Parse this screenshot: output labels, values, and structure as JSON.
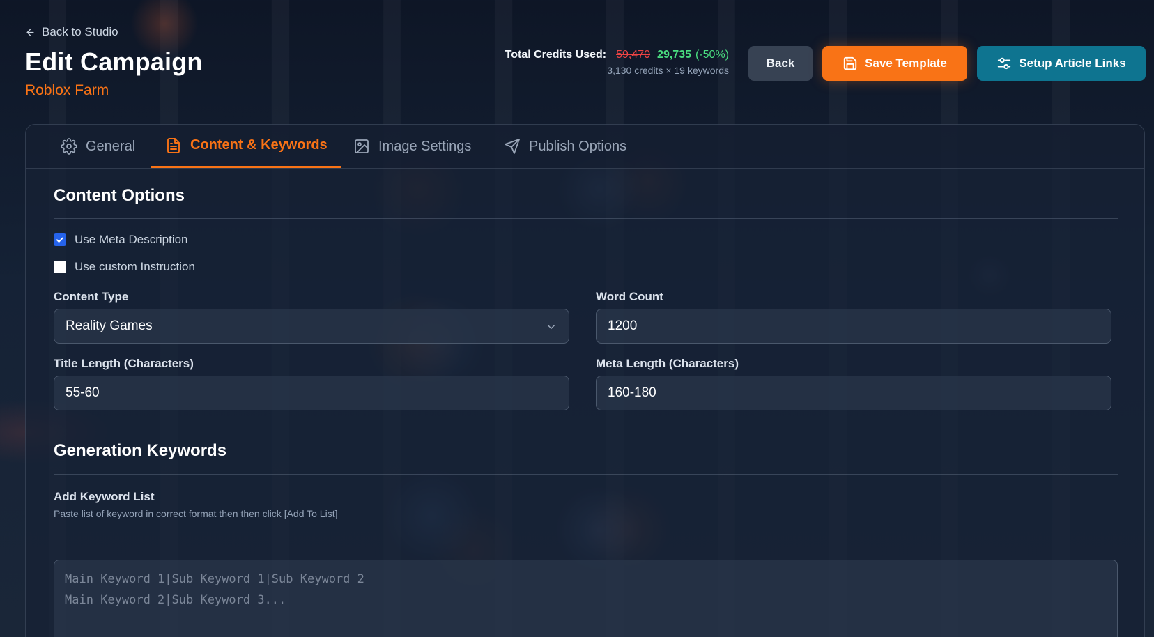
{
  "header": {
    "back_link": "Back to Studio",
    "title": "Edit Campaign",
    "campaign_name": "Roblox Farm"
  },
  "credits": {
    "label": "Total Credits Used:",
    "original": "59,470",
    "discounted": "29,735",
    "discount": "(-50%)",
    "breakdown": "3,130 credits × 19 keywords"
  },
  "actions": {
    "back": "Back",
    "save_template": "Save Template",
    "setup_links": "Setup Article Links"
  },
  "tabs": [
    {
      "label": "General",
      "icon": "gear-icon",
      "active": false
    },
    {
      "label": "Content & Keywords",
      "icon": "document-icon",
      "active": true
    },
    {
      "label": "Image Settings",
      "icon": "image-icon",
      "active": false
    },
    {
      "label": "Publish Options",
      "icon": "send-icon",
      "active": false
    }
  ],
  "content_options": {
    "title": "Content Options",
    "use_meta_description": {
      "label": "Use Meta Description",
      "checked": true
    },
    "use_custom_instruction": {
      "label": "Use custom Instruction",
      "checked": false
    },
    "content_type": {
      "label": "Content Type",
      "value": "Reality Games"
    },
    "word_count": {
      "label": "Word Count",
      "value": "1200"
    },
    "title_length": {
      "label": "Title Length (Characters)",
      "value": "55-60"
    },
    "meta_length": {
      "label": "Meta Length (Characters)",
      "value": "160-180"
    }
  },
  "generation_keywords": {
    "title": "Generation Keywords",
    "add_list_label": "Add Keyword List",
    "help": "Paste list of keyword in correct format then then click [Add To List]",
    "placeholder": "Main Keyword 1|Sub Keyword 1|Sub Keyword 2\nMain Keyword 2|Sub Keyword 3..."
  },
  "colors": {
    "accent": "#f97316",
    "teal": "#0e7490",
    "checkbox": "#2563eb",
    "strikethrough": "#ef4444",
    "success": "#4ade80"
  }
}
